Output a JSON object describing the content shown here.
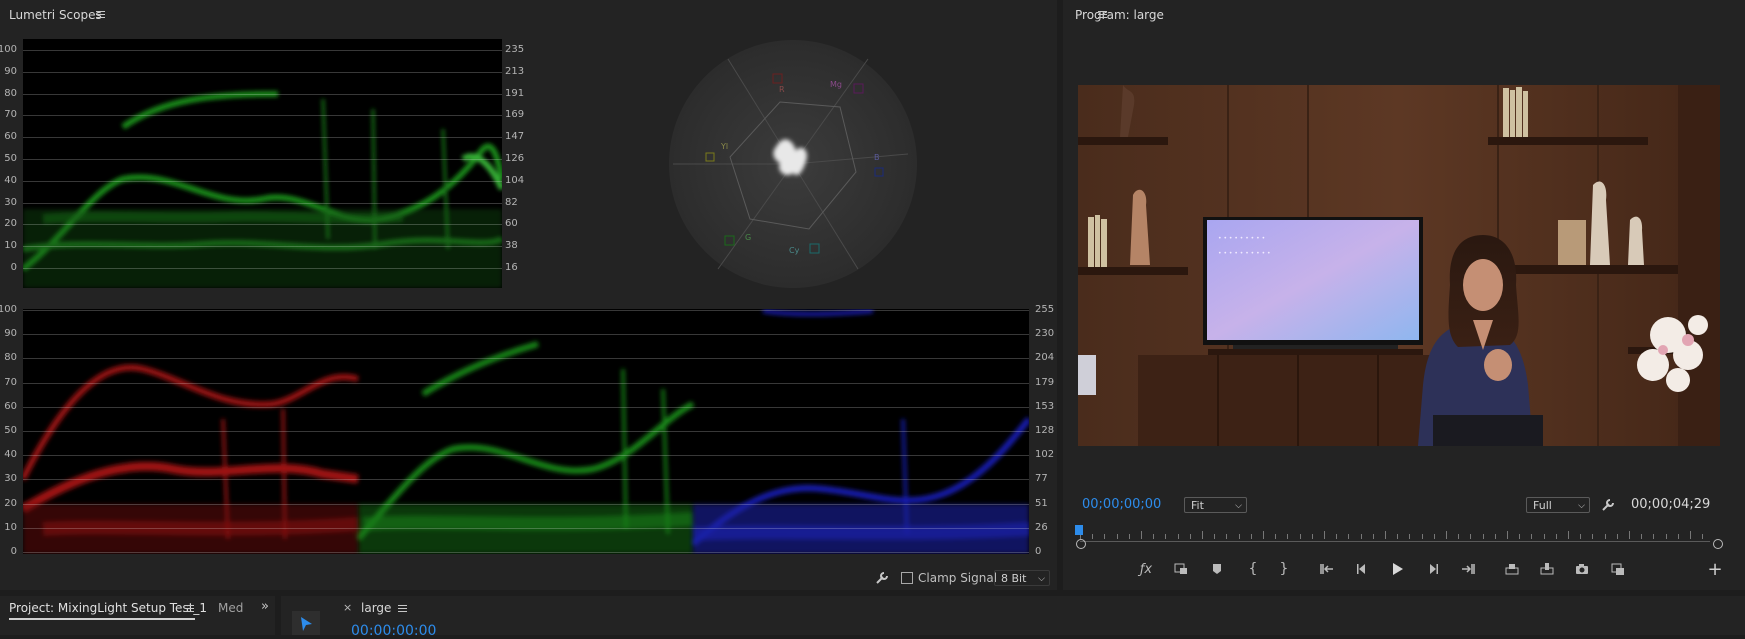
{
  "scopes": {
    "title": "Lumetri Scopes",
    "luma_left": [
      "100",
      "90",
      "80",
      "70",
      "60",
      "50",
      "40",
      "30",
      "20",
      "10",
      "0"
    ],
    "luma_right": [
      "235",
      "213",
      "191",
      "169",
      "147",
      "126",
      "104",
      "82",
      "60",
      "38",
      "16"
    ],
    "parade_left": [
      "100",
      "90",
      "80",
      "70",
      "60",
      "50",
      "40",
      "30",
      "20",
      "10",
      "0"
    ],
    "parade_right": [
      "255",
      "230",
      "204",
      "179",
      "153",
      "128",
      "102",
      "77",
      "51",
      "26",
      "0"
    ],
    "vectorscope_labels": {
      "r": "R",
      "mg": "Mg",
      "b": "B",
      "cy": "Cy",
      "g": "G",
      "yl": "Yl"
    },
    "clamp_label": "Clamp Signal",
    "bit_depth": "8 Bit"
  },
  "program": {
    "title": "Program: large",
    "timecode_current": "00;00;00;00",
    "zoom": "Fit",
    "resolution": "Full",
    "timecode_duration": "00;00;04;29",
    "tv_text_line1": "• • • • • • • • •",
    "tv_text_line2": "• • • • • • • • • •"
  },
  "project": {
    "tab_label": "Project: MixingLight Setup Test_1",
    "tab2_label": "Med"
  },
  "timeline": {
    "tab_label": "large",
    "timecode": "00:00:00:00"
  },
  "colors": {
    "accent_blue": "#2d8ceb",
    "panel_bg": "#232323",
    "divider": "#1d1d1d"
  }
}
